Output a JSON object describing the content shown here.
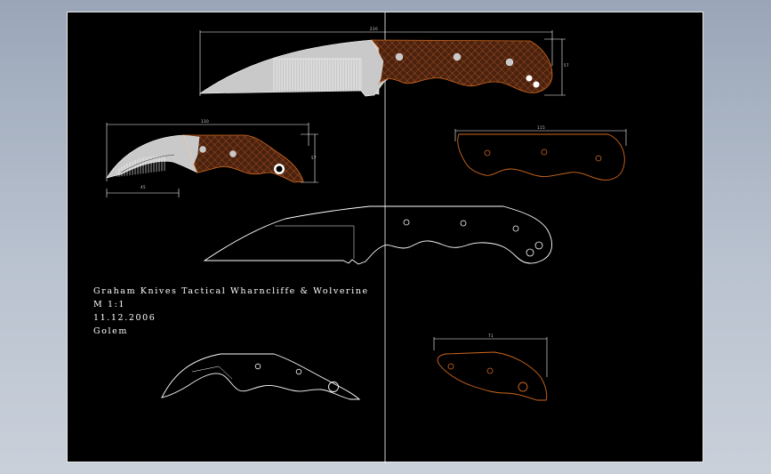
{
  "title_block": {
    "line1": "Graham Knives Tactical Wharncliffe & Wolverine",
    "line2": "M 1:1",
    "line3": "11.12.2006",
    "line4": "Golem"
  },
  "dimensions": {
    "top_knife_length": "230",
    "top_knife_height": "57",
    "claw_length": "130",
    "claw_height": "57",
    "claw_edge": "45",
    "right_scale_top": "115",
    "right_scale_bottom": "71"
  },
  "colors": {
    "background": "#000000",
    "outline": "#ffffff",
    "handle_outline": "#d2691e",
    "blade_fill": "#c9c9c9",
    "scale_fill": "#5a2a10"
  }
}
